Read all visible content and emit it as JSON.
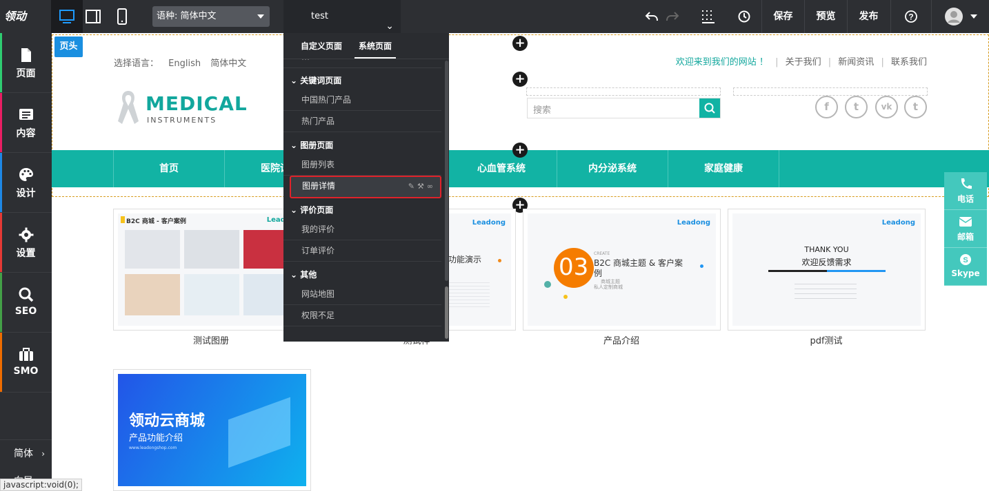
{
  "topbar": {
    "logo_text": "领动",
    "lang_selector": "语种:  简体中文",
    "page_selector": "test",
    "buttons": {
      "save": "保存",
      "preview": "预览",
      "publish": "发布"
    }
  },
  "sidebar": {
    "items": [
      {
        "label": "页面",
        "color": "#2ecc71"
      },
      {
        "label": "内容",
        "color": "#e91e63"
      },
      {
        "label": "设计",
        "color": "#1e88e5"
      },
      {
        "label": "设置",
        "color": "#e53935"
      },
      {
        "label": "SEO",
        "color": "#43a047"
      },
      {
        "label": "SMO",
        "color": "#ef6c00"
      }
    ],
    "bottom_lang": "简体",
    "bottom_next": "向导"
  },
  "status_url": "javascript:void(0);",
  "site": {
    "head_tag": "页头",
    "lang_label": "选择语言：",
    "lang_options": [
      "English",
      "简体中文"
    ],
    "welcome": "欢迎来到我们的网站 ！",
    "links": [
      "关于我们",
      "新闻资讯",
      "联系我们"
    ],
    "brand_name": "MEDICAL",
    "brand_sub": "INSTRUMENTS",
    "search_placeholder": "搜索",
    "social": [
      "f",
      "t",
      "vk",
      "t"
    ],
    "nav": [
      "首页",
      "医院设",
      "心血管系统",
      "内分泌系统",
      "家庭健康"
    ],
    "cards": [
      {
        "caption": "测试图册",
        "title": "B2C 商城 - 客户案例",
        "logo": "Leadong"
      },
      {
        "caption": "测试样",
        "title": "功能演示",
        "logo": "Leadong"
      },
      {
        "caption": "产品介绍",
        "title": "B2C 商城主题 & 客户案例",
        "num": "03",
        "create": "CREATE",
        "sub1": "商城主题",
        "sub2": "私人定制商城",
        "logo": "Leadong"
      },
      {
        "caption": "pdf测试",
        "title": "THANK YOU",
        "title2": "欢迎反馈需求",
        "logo": "Leadong"
      },
      {
        "caption": "",
        "title": "领动云商城",
        "subtitle": "产品功能介绍",
        "url": "www.leadongshop.com"
      }
    ]
  },
  "dropdown": {
    "tabs": [
      "自定义页面",
      "系统页面"
    ],
    "groups": [
      {
        "title": "关键词页面",
        "items": [
          "中国热门产品",
          "热门产品"
        ]
      },
      {
        "title": "图册页面",
        "items": [
          "图册列表",
          "图册详情"
        ]
      },
      {
        "title": "评价页面",
        "items": [
          "我的评价",
          "订单评价"
        ]
      },
      {
        "title": "其他",
        "items": [
          "网站地图",
          "权限不足"
        ]
      }
    ],
    "selected": "图册详情"
  },
  "float_bar": [
    "电话",
    "邮箱",
    "Skype"
  ]
}
